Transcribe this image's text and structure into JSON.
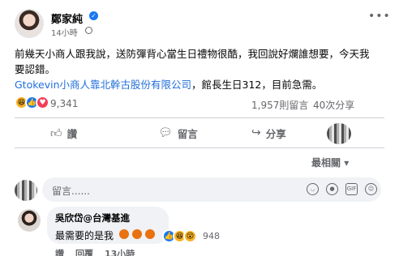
{
  "post": {
    "author": "鄭家純",
    "time": "14小時",
    "text": "前幾天小商人跟我說，送防彈背心當生日禮物很酷，我回說好爛誰想要，今天我要認錯。",
    "link_text": "Gtokevin小商人靠北幹古股份有限公司",
    "link_suffix": "，館長生日312，目前急需。",
    "reaction_count": "9,341",
    "comment_count": "1,957則留言",
    "share_count": "40次分享"
  },
  "actions": {
    "like": "讚",
    "comment": "留言",
    "share": "分享"
  },
  "sort_label": "最相關",
  "comment_input": {
    "placeholder": "留言......"
  },
  "comment": {
    "author": "吳欣岱@台灣基進",
    "text": "最需要的是我",
    "reaction_count": "948",
    "like_label": "讚",
    "reply_label": "回覆",
    "time": "13小時"
  },
  "colors": {
    "link": "#216fdb",
    "like_blue": "#1877f2",
    "secondary_text": "#65676b"
  },
  "icons": [
    "verified-icon",
    "globe-icon",
    "more-icon",
    "like-icon",
    "comment-icon",
    "share-icon",
    "emoji-icon",
    "camera-icon",
    "gif-icon",
    "sticker-icon"
  ]
}
